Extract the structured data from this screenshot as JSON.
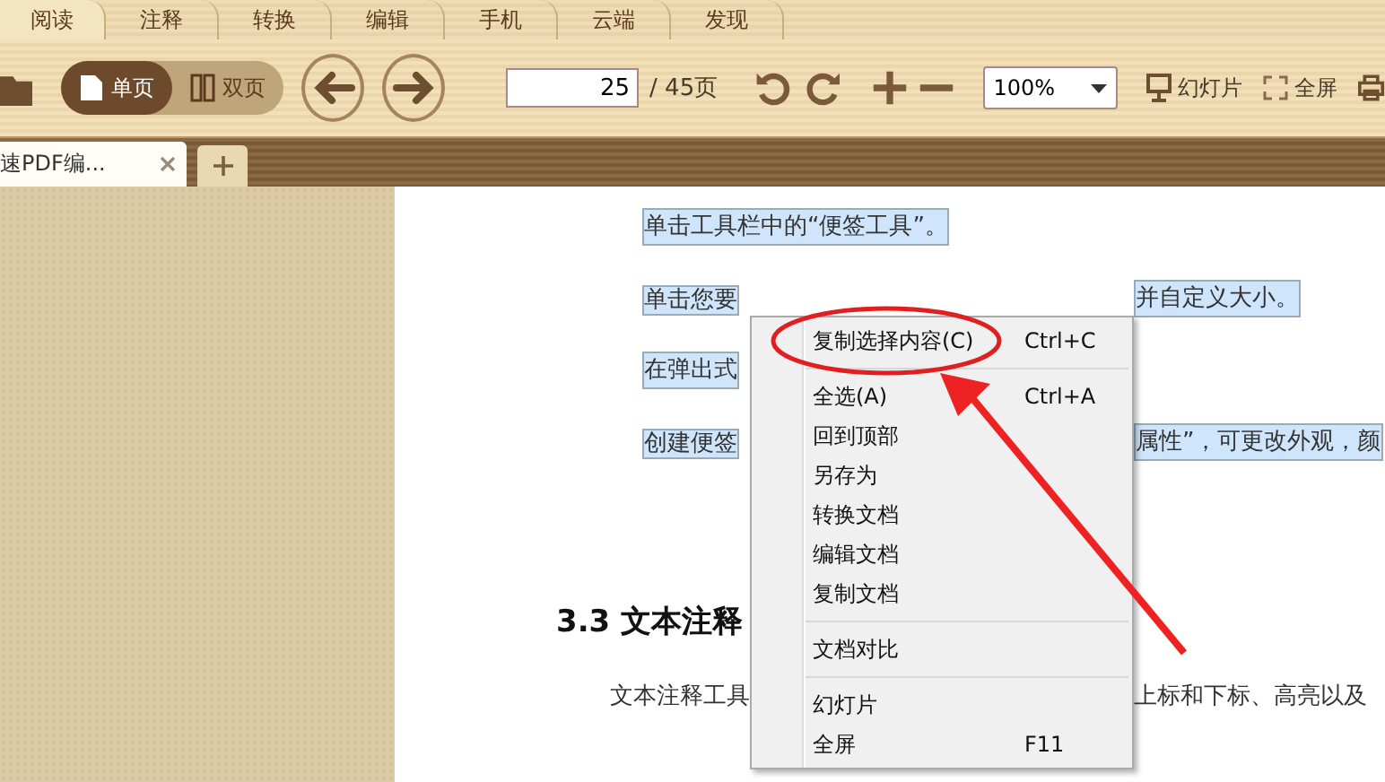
{
  "ribbon_tabs": [
    {
      "label": "阅读",
      "selected": true
    },
    {
      "label": "注释",
      "selected": false
    },
    {
      "label": "转换",
      "selected": false
    },
    {
      "label": "编辑",
      "selected": false
    },
    {
      "label": "手机",
      "selected": false
    },
    {
      "label": "云端",
      "selected": false
    },
    {
      "label": "发现",
      "selected": false
    }
  ],
  "toolbar": {
    "view_modes": [
      {
        "label": "单页",
        "selected": true
      },
      {
        "label": "双页",
        "selected": false
      }
    ],
    "page_input": "25",
    "page_total": "/ 45页",
    "zoom": "100%",
    "slideshow": "幻灯片",
    "fullscreen": "全屏"
  },
  "doc_tabs": [
    {
      "label": "速PDF编...",
      "selected": true
    }
  ],
  "document": {
    "paragraphs": [
      {
        "left": "单击工具栏中的“便签工具”。"
      },
      {
        "left": "单击您要",
        "right": "并自定义大小。"
      },
      {
        "left": "在弹出式"
      },
      {
        "left": "创建便签",
        "right": "属性”，可更改外观，颜"
      }
    ],
    "heading": "3.3 文本注释",
    "body": {
      "left": "文本注释工具",
      "right": "上标和下标、高亮以及"
    }
  },
  "context_menu": [
    {
      "kind": "item",
      "label": "复制选择内容(C)",
      "shortcut": "Ctrl+C",
      "circled": true
    },
    {
      "kind": "separator"
    },
    {
      "kind": "item",
      "label": "全选(A)",
      "shortcut": "Ctrl+A",
      "circled": false
    },
    {
      "kind": "item",
      "label": "回到顶部",
      "circled": false
    },
    {
      "kind": "item",
      "label": "另存为",
      "circled": false
    },
    {
      "kind": "item",
      "label": "转换文档",
      "circled": false
    },
    {
      "kind": "item",
      "label": "编辑文档",
      "circled": false
    },
    {
      "kind": "item",
      "label": "复制文档",
      "circled": false
    },
    {
      "kind": "separator"
    },
    {
      "kind": "item",
      "label": "文档对比",
      "circled": false
    },
    {
      "kind": "separator"
    },
    {
      "kind": "item",
      "label": "幻灯片",
      "circled": false
    },
    {
      "kind": "item",
      "label": "全屏",
      "shortcut": "F11",
      "circled": false
    }
  ]
}
